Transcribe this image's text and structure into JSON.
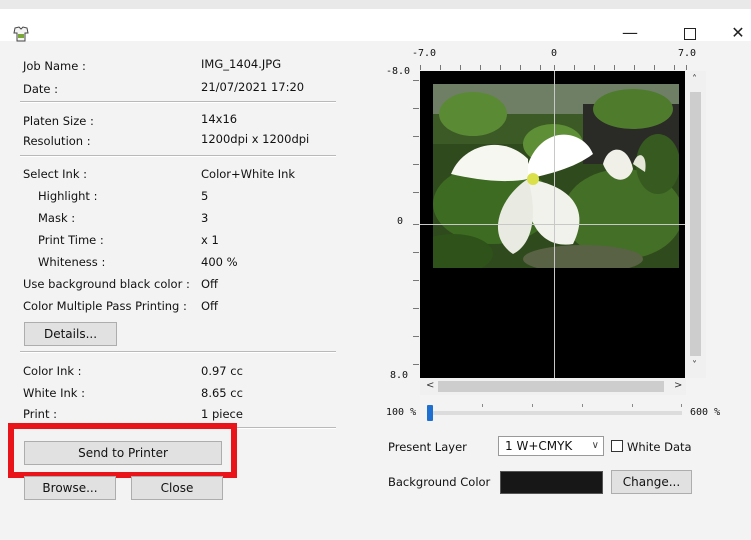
{
  "window": {
    "minimize_glyph": "—",
    "close_glyph": "✕"
  },
  "job": {
    "job_name_label": "Job Name :",
    "job_name_value": "IMG_1404.JPG",
    "date_label": "Date :",
    "date_value": "21/07/2021 17:20",
    "platen_label": "Platen Size :",
    "platen_value": "14x16",
    "resolution_label": "Resolution :",
    "resolution_value": "1200dpi x 1200dpi"
  },
  "ink": {
    "select_ink_label": "Select Ink :",
    "select_ink_value": "Color+White Ink",
    "highlight_label": "Highlight :",
    "highlight_value": "5",
    "mask_label": "Mask :",
    "mask_value": "3",
    "print_time_label": "Print Time :",
    "print_time_value": "x 1",
    "whiteness_label": "Whiteness :",
    "whiteness_value": "400 %",
    "bg_black_label": "Use background black color :",
    "bg_black_value": "Off",
    "multi_pass_label": "Color Multiple Pass Printing :",
    "multi_pass_value": "Off",
    "details_button": "Details..."
  },
  "usage": {
    "color_ink_label": "Color Ink :",
    "color_ink_value": "0.97 cc",
    "white_ink_label": "White Ink :",
    "white_ink_value": "8.65 cc",
    "print_label": "Print :",
    "print_value": "1 piece"
  },
  "actions": {
    "send_to_printer": "Send to Printer",
    "browse": "Browse...",
    "close": "Close"
  },
  "preview": {
    "ruler_top_left": "-7.0",
    "ruler_top_center": "0",
    "ruler_top_right": "7.0",
    "ruler_left_top": "-8.0",
    "ruler_left_center": "0",
    "ruler_left_bottom": "8.0",
    "scroll_up": "˄",
    "scroll_down": "˅",
    "scroll_left": "<",
    "scroll_right": ">"
  },
  "zoom": {
    "min_label": "100 %",
    "max_label": "600 %",
    "value_percent": 100
  },
  "layer": {
    "present_layer_label": "Present Layer",
    "present_layer_value": "1  W+CMYK",
    "dropdown_glyph": "∨",
    "white_data_label": "White Data",
    "white_data_checked": false
  },
  "background": {
    "label": "Background Color",
    "color": "#171717",
    "change_button": "Change..."
  },
  "colors": {
    "highlight_frame": "#e8141a",
    "slider_thumb": "#1f6fd0"
  }
}
